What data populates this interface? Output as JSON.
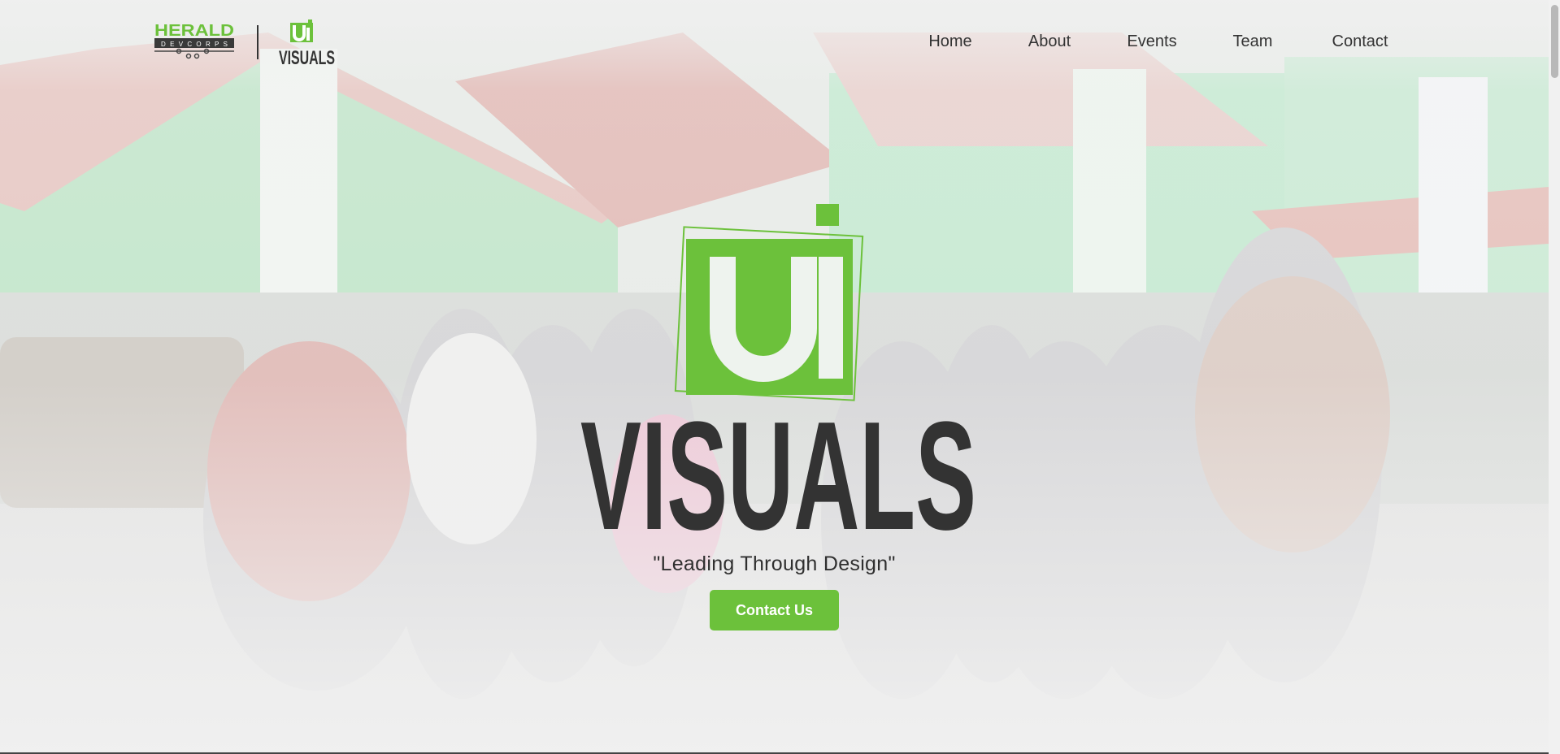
{
  "brand": {
    "herald_logo": "HERALD",
    "devcorps_logo": "DEVCORPS",
    "ui_logo": "UI",
    "visuals_logo": "VISUALS"
  },
  "nav": {
    "items": [
      {
        "label": "Home"
      },
      {
        "label": "About"
      },
      {
        "label": "Events"
      },
      {
        "label": "Team"
      },
      {
        "label": "Contact"
      }
    ]
  },
  "hero": {
    "mark": "UI",
    "title": "VISUALS",
    "tagline": "\"Leading Through Design\"",
    "cta_label": "Contact Us"
  },
  "colors": {
    "accent": "#6cc13b",
    "text_dark": "#333333"
  }
}
